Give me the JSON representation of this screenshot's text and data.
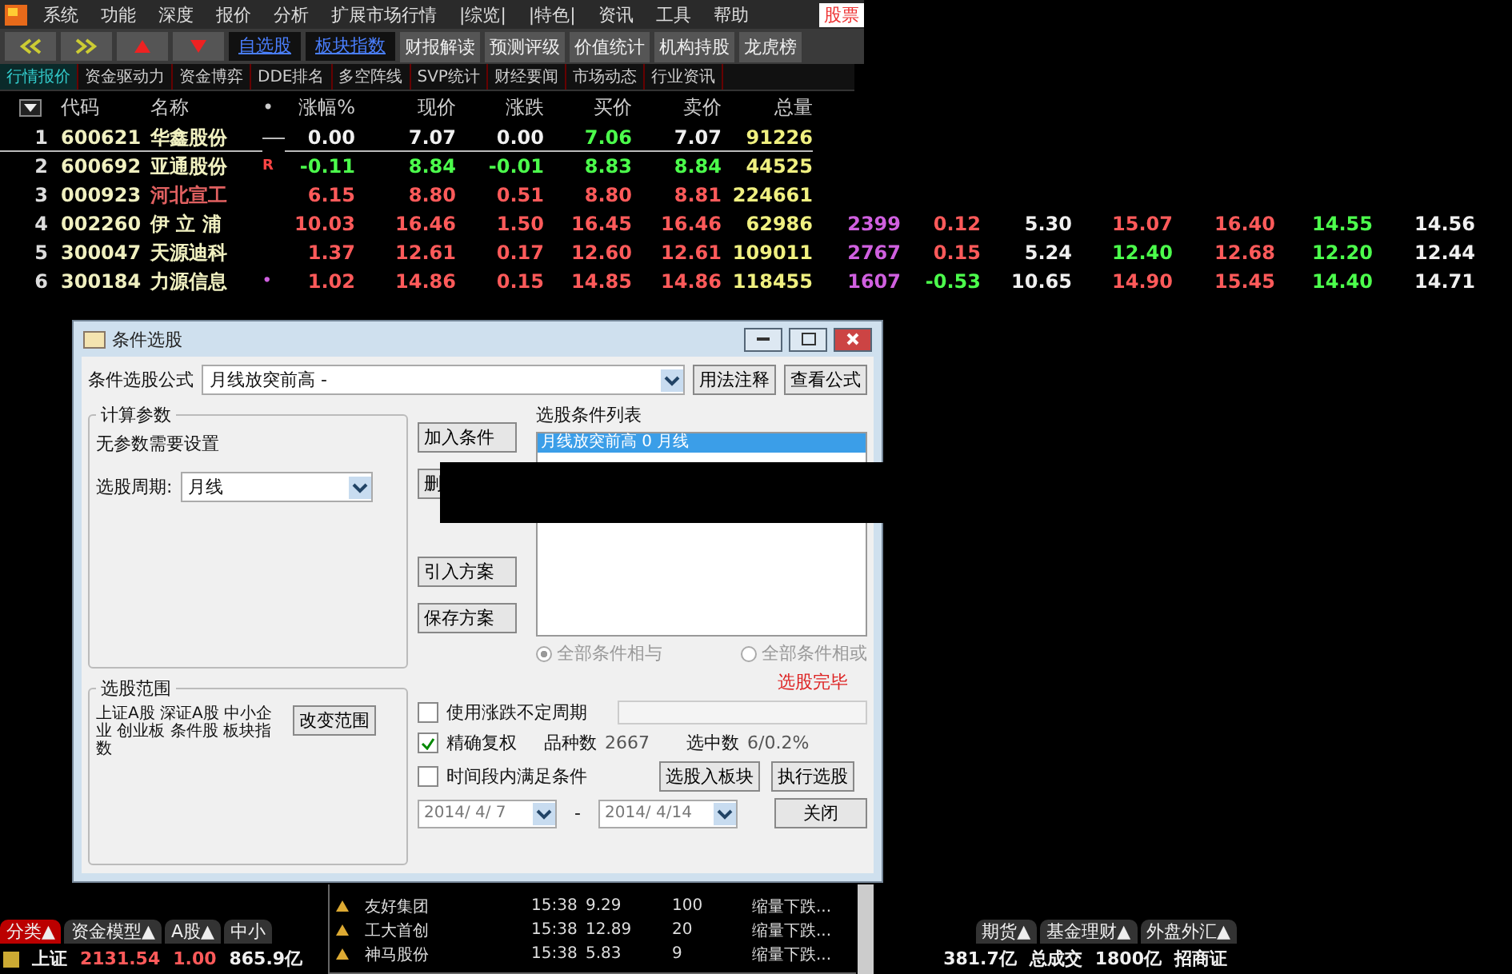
{
  "menu": {
    "items": [
      "系统",
      "功能",
      "深度",
      "报价",
      "分析",
      "扩展市场行情",
      "|综览|",
      "|特色|",
      "资讯",
      "工具",
      "帮助"
    ],
    "brand": "股票"
  },
  "toolbar": {
    "links": [
      "自选股",
      "板块指数"
    ],
    "buttons": [
      "财报解读",
      "预测评级",
      "价值统计",
      "机构持股",
      "龙虎榜"
    ]
  },
  "tabs": [
    {
      "label": "行情报价",
      "selected": true
    },
    {
      "label": "资金驱动力",
      "selected": false
    },
    {
      "label": "资金博弈",
      "selected": false
    },
    {
      "label": "DDE排名",
      "selected": false
    },
    {
      "label": "多空阵线",
      "selected": false
    },
    {
      "label": "SVP统计",
      "selected": false
    },
    {
      "label": "财经要闻",
      "selected": false
    },
    {
      "label": "市场动态",
      "selected": false
    },
    {
      "label": "行业资讯",
      "selected": false
    }
  ],
  "table": {
    "columns": [
      "代码",
      "名称",
      "•",
      "涨幅%",
      "现价",
      "涨跌",
      "买价",
      "卖价",
      "总量"
    ],
    "rows": [
      {
        "no": "1",
        "code": "600621",
        "name": {
          "text": "华鑫股份",
          "color": "#f0f0c0"
        },
        "mark": "",
        "selected": true,
        "values": [
          {
            "text": "0.00",
            "color": "#f0f0f0"
          },
          {
            "text": "7.07",
            "color": "#f0f0f0"
          },
          {
            "text": "0.00",
            "color": "#f0f0f0"
          },
          {
            "text": "7.06",
            "color": "#4cff4c"
          },
          {
            "text": "7.07",
            "color": "#f0f0f0"
          }
        ],
        "volume": "91226",
        "extra": []
      },
      {
        "no": "2",
        "code": "600692",
        "name": {
          "text": "亚通股份",
          "color": "#f0f0c0"
        },
        "mark": "R",
        "selected": false,
        "values": [
          {
            "text": "-0.11",
            "color": "#4cff4c"
          },
          {
            "text": "8.84",
            "color": "#4cff4c"
          },
          {
            "text": "-0.01",
            "color": "#4cff4c"
          },
          {
            "text": "8.83",
            "color": "#4cff4c"
          },
          {
            "text": "8.84",
            "color": "#4cff4c"
          }
        ],
        "volume": "44525",
        "extra": []
      },
      {
        "no": "3",
        "code": "000923",
        "name": {
          "text": "河北宣工",
          "color": "#e06060"
        },
        "mark": "",
        "selected": false,
        "values": [
          {
            "text": "6.15",
            "color": "#ff5a5a"
          },
          {
            "text": "8.80",
            "color": "#ff5a5a"
          },
          {
            "text": "0.51",
            "color": "#ff5a5a"
          },
          {
            "text": "8.80",
            "color": "#ff5a5a"
          },
          {
            "text": "8.81",
            "color": "#ff5a5a"
          }
        ],
        "volume": "224661",
        "extra": []
      },
      {
        "no": "4",
        "code": "002260",
        "name": {
          "text": "伊 立 浦",
          "color": "#f0f0c0"
        },
        "mark": "",
        "selected": false,
        "values": [
          {
            "text": "10.03",
            "color": "#ff5a5a"
          },
          {
            "text": "16.46",
            "color": "#ff5a5a"
          },
          {
            "text": "1.50",
            "color": "#ff5a5a"
          },
          {
            "text": "16.45",
            "color": "#ff5a5a"
          },
          {
            "text": "16.46",
            "color": "#ff5a5a"
          }
        ],
        "volume": "62986",
        "extra": [
          {
            "text": "2399",
            "color": "#d060e0"
          },
          {
            "text": "0.12",
            "color": "#ff5a5a"
          },
          {
            "text": "5.30",
            "color": "#f0f0f0"
          },
          {
            "text": "15.07",
            "color": "#ff5a5a"
          },
          {
            "text": "16.40",
            "color": "#ff5a5a"
          },
          {
            "text": "14.55",
            "color": "#4cff4c"
          },
          {
            "text": "14.56",
            "color": "#f0f0f0"
          }
        ]
      },
      {
        "no": "5",
        "code": "300047",
        "name": {
          "text": "天源迪科",
          "color": "#f0f0c0"
        },
        "mark": "",
        "selected": false,
        "values": [
          {
            "text": "1.37",
            "color": "#ff5a5a"
          },
          {
            "text": "12.61",
            "color": "#ff5a5a"
          },
          {
            "text": "0.17",
            "color": "#ff5a5a"
          },
          {
            "text": "12.60",
            "color": "#ff5a5a"
          },
          {
            "text": "12.61",
            "color": "#ff5a5a"
          }
        ],
        "volume": "109011",
        "extra": [
          {
            "text": "2767",
            "color": "#d060e0"
          },
          {
            "text": "0.15",
            "color": "#ff5a5a"
          },
          {
            "text": "5.24",
            "color": "#f0f0f0"
          },
          {
            "text": "12.40",
            "color": "#4cff4c"
          },
          {
            "text": "12.68",
            "color": "#ff5a5a"
          },
          {
            "text": "12.20",
            "color": "#4cff4c"
          },
          {
            "text": "12.44",
            "color": "#f0f0f0"
          }
        ]
      },
      {
        "no": "6",
        "code": "300184",
        "name": {
          "text": "力源信息",
          "color": "#f0f0c0"
        },
        "mark": "•",
        "selected": false,
        "values": [
          {
            "text": "1.02",
            "color": "#ff5a5a"
          },
          {
            "text": "14.86",
            "color": "#ff5a5a"
          },
          {
            "text": "0.15",
            "color": "#ff5a5a"
          },
          {
            "text": "14.85",
            "color": "#ff5a5a"
          },
          {
            "text": "14.86",
            "color": "#ff5a5a"
          }
        ],
        "volume": "118455",
        "extra": [
          {
            "text": "1607",
            "color": "#d060e0"
          },
          {
            "text": "-0.53",
            "color": "#4cff4c"
          },
          {
            "text": "10.65",
            "color": "#f0f0f0"
          },
          {
            "text": "14.90",
            "color": "#ff5a5a"
          },
          {
            "text": "15.45",
            "color": "#ff5a5a"
          },
          {
            "text": "14.40",
            "color": "#4cff4c"
          },
          {
            "text": "14.71",
            "color": "#f0f0f0"
          }
        ]
      }
    ]
  },
  "dialog": {
    "title": "条件选股",
    "formula_label": "条件选股公式",
    "formula": "月线放突前高 -",
    "top_buttons": [
      "用法注释",
      "查看公式"
    ],
    "params_title": "计算参数",
    "params_text": "无参数需要设置",
    "period_label": "选股周期:",
    "period": "月线",
    "range_title": "选股范围",
    "range_text": "上证A股 深证A股 中小企业 创业板 条件股 板块指数",
    "range_button": "改变范围",
    "side_buttons": [
      "加入条件",
      "删",
      "引入方案",
      "保存方案"
    ],
    "list_title": "选股条件列表",
    "conditions": [
      {
        "text": "月线放突前高 0 月线",
        "selected": true
      }
    ],
    "radios": [
      {
        "label": "全部条件相与",
        "selected": true
      },
      {
        "label": "全部条件相或",
        "selected": false
      }
    ],
    "status": "选股完毕",
    "options": [
      {
        "label": "使用涨跌不定周期",
        "checked": false
      },
      {
        "label": "精确复权",
        "checked": true
      },
      {
        "label": "时间段内满足条件",
        "checked": false
      }
    ],
    "count_label": "品种数",
    "count": "2667",
    "hit_label": "选中数",
    "hit": "6/0.2%",
    "action_buttons": [
      "选股入板块",
      "执行选股"
    ],
    "date_from": "2014/ 4/ 7",
    "date_sep": "-",
    "date_to": "2014/ 4/14",
    "close": "关闭"
  },
  "popup_list": [
    {
      "name": "友好集团",
      "time": "15:38",
      "price": "9.29",
      "vol": "100",
      "note": "缩量下跌..."
    },
    {
      "name": "工大首创",
      "time": "15:38",
      "price": "12.89",
      "vol": "20",
      "note": "缩量下跌..."
    },
    {
      "name": "神马股份",
      "time": "15:38",
      "price": "5.83",
      "vol": "9",
      "note": "缩量下跌..."
    }
  ],
  "bottom_tabs": {
    "left": [
      {
        "label": "分类▲",
        "selected": true
      },
      {
        "label": "资金模型▲",
        "selected": false
      },
      {
        "label": "A股▲",
        "selected": false
      },
      {
        "label": "中小",
        "selected": false
      }
    ],
    "right": [
      {
        "label": "期货▲",
        "selected": false
      },
      {
        "label": "基金理财▲",
        "selected": false
      },
      {
        "label": "外盘外汇▲",
        "selected": false
      }
    ]
  },
  "status_bar": {
    "left": [
      {
        "text": "上证",
        "color": "#f0f0f0"
      },
      {
        "text": "2131.54",
        "color": "#ff5a5a"
      },
      {
        "text": "1.00",
        "color": "#ff5a5a"
      },
      {
        "text": "865.9亿",
        "color": "#f0f0f0"
      }
    ],
    "right": [
      {
        "text": "381.7亿",
        "color": "#f0f0f0"
      },
      {
        "text": "总成交",
        "color": "#f0f0f0"
      },
      {
        "text": "1800亿",
        "color": "#f0f0f0"
      },
      {
        "text": "招商证",
        "color": "#f0f0f0"
      }
    ]
  }
}
